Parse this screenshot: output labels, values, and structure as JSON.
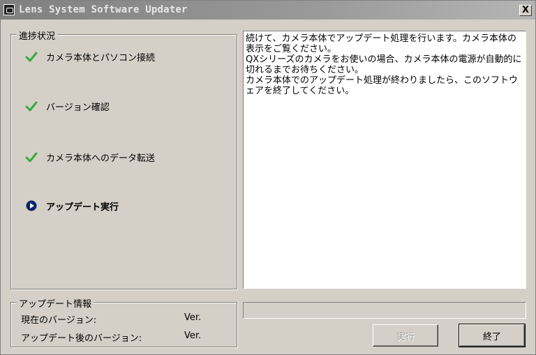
{
  "window": {
    "title": "Lens System Software Updater",
    "close_label": "X"
  },
  "progress_group": {
    "title": "進捗状況",
    "steps": [
      {
        "label": "カメラ本体とパソコン接続",
        "state": "done",
        "icon": "check-icon"
      },
      {
        "label": "バージョン確認",
        "state": "done",
        "icon": "check-icon"
      },
      {
        "label": "カメラ本体へのデータ転送",
        "state": "done",
        "icon": "check-icon"
      },
      {
        "label": "アップデート実行",
        "state": "active",
        "icon": "play-circle-icon"
      }
    ]
  },
  "message": {
    "lines": [
      "続けて、カメラ本体でアップデート処理を行います。カメラ本体の表示をご覧ください。",
      "QXシリーズのカメラをお使いの場合、カメラ本体の電源が自動的に切れるまでお待ちください。",
      "カメラ本体でのアップデート処理が終わりましたら、このソフトウェアを終了してください。"
    ]
  },
  "update_info": {
    "title": "アップデート情報",
    "current_label": "現在のバージョン:",
    "current_value": "Ver.",
    "after_label": "アップデート後のバージョン:",
    "after_value": "Ver."
  },
  "progress_bar": {
    "value": 0
  },
  "buttons": {
    "execute_label": "実行",
    "execute_enabled": false,
    "exit_label": "終了"
  },
  "colors": {
    "check": "#3aa83a",
    "active": "#0a246a",
    "title_text": "#e8e8e8"
  }
}
